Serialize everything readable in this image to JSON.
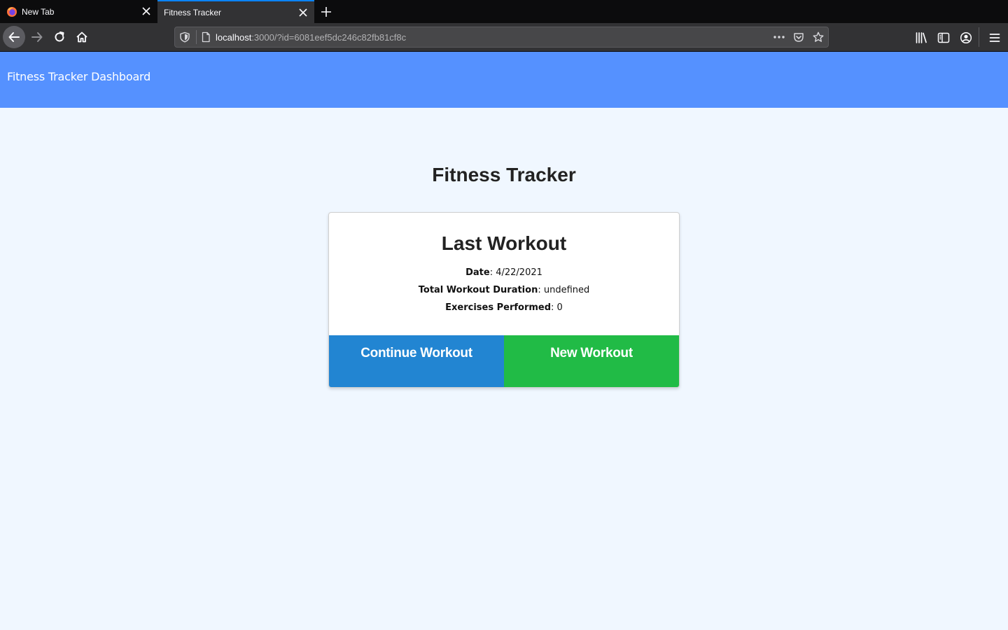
{
  "browser": {
    "tabs": [
      {
        "title": "New Tab",
        "active": false
      },
      {
        "title": "Fitness Tracker",
        "active": true
      }
    ],
    "url": {
      "host": "localhost",
      "rest": ":3000/?id=6081eef5dc246c82fb81cf8c"
    }
  },
  "header": {
    "brand": "Fitness Tracker Dashboard"
  },
  "main": {
    "title": "Fitness Tracker",
    "card": {
      "title": "Last Workout",
      "stats": [
        {
          "label": "Date",
          "value": ": 4/22/2021"
        },
        {
          "label": "Total Workout Duration",
          "value": ": undefined"
        },
        {
          "label": "Exercises Performed",
          "value": ": 0"
        }
      ],
      "buttons": {
        "continue": "Continue Workout",
        "new": "New Workout"
      }
    }
  },
  "colors": {
    "header_bg": "#5591ff",
    "page_bg": "#f0f7ff",
    "continue_button": "#2285d2",
    "new_button": "#21bb46"
  },
  "icons": [
    "firefox-icon",
    "close-icon",
    "plus-icon",
    "back-arrow-icon",
    "forward-arrow-icon",
    "reload-icon",
    "home-icon",
    "shield-icon",
    "page-icon",
    "more-icon",
    "pocket-icon",
    "star-icon",
    "library-icon",
    "sidebar-icon",
    "account-icon",
    "menu-icon"
  ]
}
